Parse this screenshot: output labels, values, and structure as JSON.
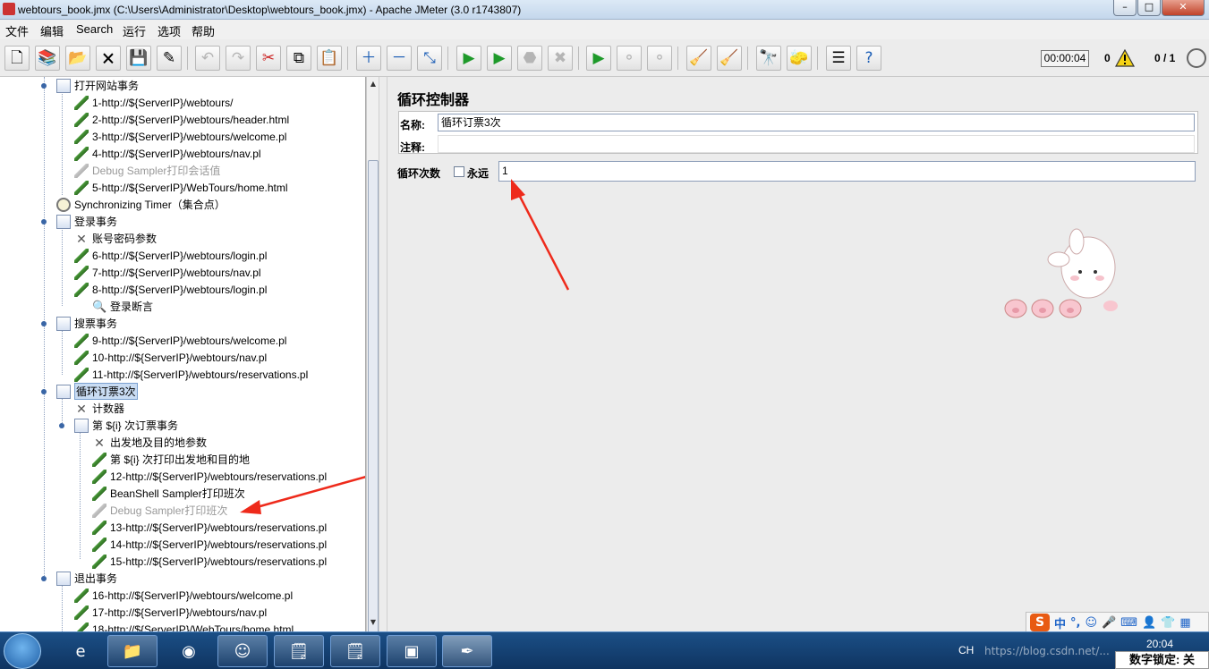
{
  "window": {
    "title": "webtours_book.jmx (C:\\Users\\Administrator\\Desktop\\webtours_book.jmx) - Apache JMeter (3.0 r1743807)"
  },
  "menu": [
    "文件",
    "编辑",
    "Search",
    "运行",
    "选项",
    "帮助"
  ],
  "toolbar": {
    "timer": "00:00:04",
    "error_count": "0",
    "threads": "0 / 1"
  },
  "tree": {
    "items": [
      {
        "label": "打开网站事务"
      },
      {
        "label": "1-http://${ServerIP}/webtours/"
      },
      {
        "label": "2-http://${ServerIP}/webtours/header.html"
      },
      {
        "label": "3-http://${ServerIP}/webtours/welcome.pl"
      },
      {
        "label": "4-http://${ServerIP}/webtours/nav.pl"
      },
      {
        "label": "Debug Sampler打印会话值"
      },
      {
        "label": "5-http://${ServerIP}/WebTours/home.html"
      },
      {
        "label": "Synchronizing Timer（集合点）"
      },
      {
        "label": "登录事务"
      },
      {
        "label": "账号密码参数"
      },
      {
        "label": "6-http://${ServerIP}/webtours/login.pl"
      },
      {
        "label": "7-http://${ServerIP}/webtours/nav.pl"
      },
      {
        "label": "8-http://${ServerIP}/webtours/login.pl"
      },
      {
        "label": "登录断言"
      },
      {
        "label": "搜票事务"
      },
      {
        "label": "9-http://${ServerIP}/webtours/welcome.pl"
      },
      {
        "label": "10-http://${ServerIP}/webtours/nav.pl"
      },
      {
        "label": "11-http://${ServerIP}/webtours/reservations.pl"
      },
      {
        "label": "循环订票3次"
      },
      {
        "label": "计数器"
      },
      {
        "label": "第 ${i} 次订票事务"
      },
      {
        "label": "出发地及目的地参数"
      },
      {
        "label": "第 ${i} 次打印出发地和目的地"
      },
      {
        "label": "12-http://${ServerIP}/webtours/reservations.pl"
      },
      {
        "label": "BeanShell Sampler打印班次"
      },
      {
        "label": "Debug Sampler打印班次"
      },
      {
        "label": "13-http://${ServerIP}/webtours/reservations.pl"
      },
      {
        "label": "14-http://${ServerIP}/webtours/reservations.pl"
      },
      {
        "label": "15-http://${ServerIP}/webtours/reservations.pl"
      },
      {
        "label": "退出事务"
      },
      {
        "label": "16-http://${ServerIP}/webtours/welcome.pl"
      },
      {
        "label": "17-http://${ServerIP}/webtours/nav.pl"
      },
      {
        "label": "18-http://${ServerIP}/WebTours/home.html"
      }
    ]
  },
  "panel": {
    "title": "循环控制器",
    "name_label": "名称:",
    "name_value": "循环订票3次",
    "comment_label": "注释:",
    "comment_value": "",
    "loop_label": "循环次数",
    "forever_label": "永远",
    "loop_value": "1"
  },
  "ime": {
    "lang": "中",
    "s_badge": "S"
  },
  "tray": {
    "lang": "CH",
    "time": "20:04",
    "numlock": "数字锁定: 关"
  },
  "watermark": "https://blog.csdn.net/..."
}
